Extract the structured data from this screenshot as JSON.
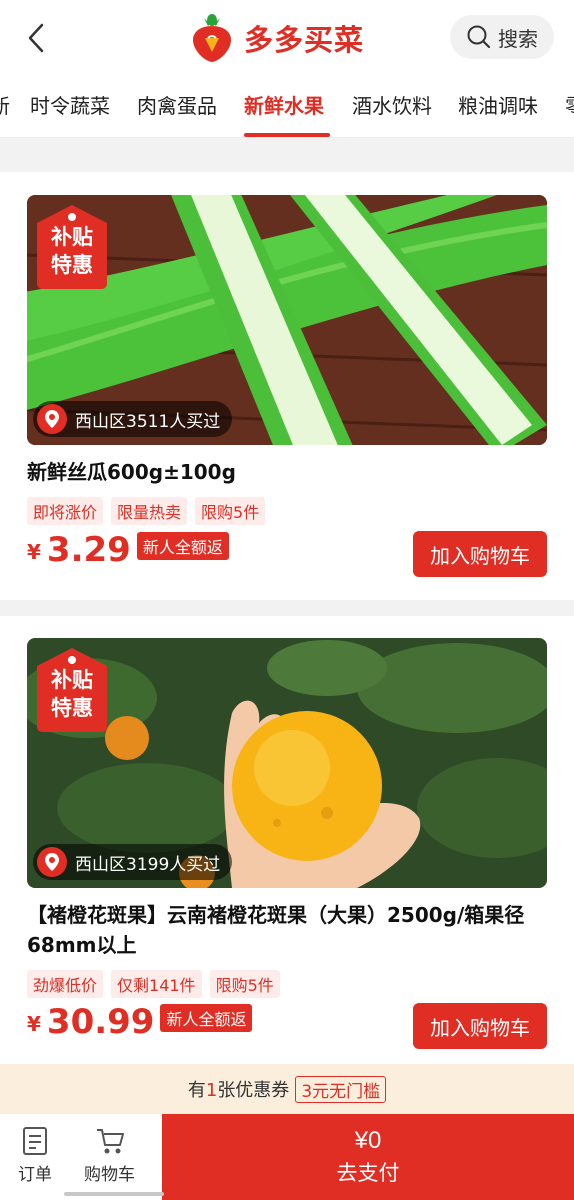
{
  "header": {
    "app_name": "多多买菜",
    "search_label": "搜索"
  },
  "tabs": [
    {
      "label": "新",
      "active": false
    },
    {
      "label": "时令蔬菜",
      "active": false
    },
    {
      "label": "肉禽蛋品",
      "active": false
    },
    {
      "label": "新鲜水果",
      "active": true
    },
    {
      "label": "酒水饮料",
      "active": false
    },
    {
      "label": "粮油调味",
      "active": false
    },
    {
      "label": "零",
      "active": false
    }
  ],
  "products": [
    {
      "badge_line1": "补贴",
      "badge_line2": "特惠",
      "buyers_text": "西山区3511人买过",
      "title": "新鲜丝瓜600g±100g",
      "tags": [
        "即将涨价",
        "限量热卖",
        "限购5件"
      ],
      "currency": "¥",
      "price": "3.29",
      "promo": "新人全额返",
      "cart_button": "加入购物车"
    },
    {
      "badge_line1": "补贴",
      "badge_line2": "特惠",
      "buyers_text": "西山区3199人买过",
      "title": "【褚橙花斑果】云南褚橙花斑果（大果）2500g/箱果径68mm以上",
      "tags": [
        "劲爆低价",
        "仅剩141件",
        "限购5件"
      ],
      "currency": "¥",
      "price": "30.99",
      "promo": "新人全额返",
      "cart_button": "加入购物车"
    }
  ],
  "coupon": {
    "prefix": "有",
    "count": "1",
    "suffix": "张优惠券",
    "badge": "3元无门槛"
  },
  "bottom_nav": {
    "orders_label": "订单",
    "cart_label": "购物车",
    "pay_amount": "¥0",
    "pay_label": "去支付"
  },
  "colors": {
    "accent": "#e02e24",
    "tag_bg": "#fdecea",
    "coupon_bg": "#fbeedc"
  }
}
